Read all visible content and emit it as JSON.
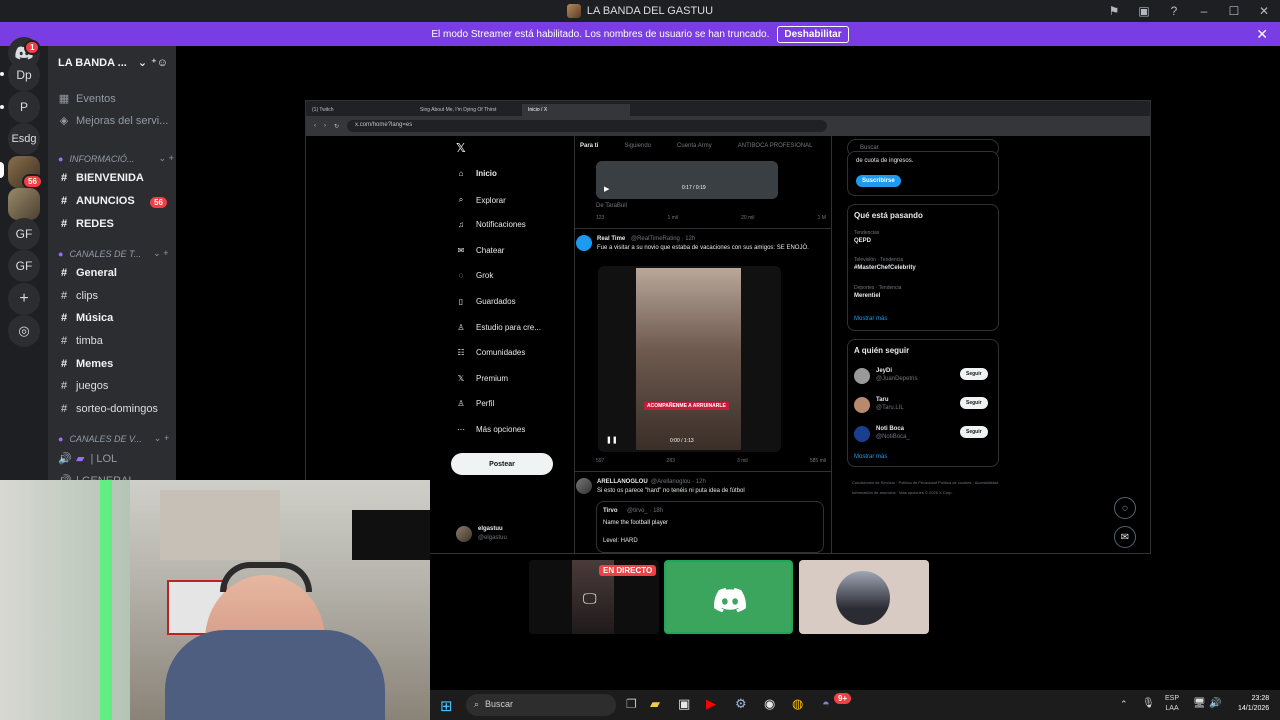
{
  "window": {
    "title": "LA BANDA DEL GASTUU"
  },
  "banner": {
    "text": "El modo Streamer está habilitado. Los nombres de usuario se han truncado.",
    "button": "Deshabilitar"
  },
  "rail": {
    "items": [
      "Dp",
      "P",
      "Esdg",
      "GF",
      "GF"
    ],
    "badges": {
      "home": "1",
      "server": "56"
    }
  },
  "sidebar": {
    "server_name": "LA BANDA ...",
    "top_items": [
      "Eventos",
      "Mejoras del servi..."
    ],
    "categories": [
      "INFORMACIÓ...",
      "CANALES DE T...",
      "CANALES DE V..."
    ],
    "info_channels": [
      "BIENVENIDA",
      "ANUNCIOS",
      "REDES"
    ],
    "anuncios_badge": "56",
    "text_channels": [
      "General",
      "clips",
      "Música",
      "timba",
      "Memes",
      "juegos",
      "sorteo-domingos"
    ],
    "voice_channels": [
      "| LOL",
      "| GENERAL"
    ]
  },
  "browser": {
    "tabs": [
      "(1) Twitch",
      "Sing About Me, I'm Dying Of Thirst",
      "Inicio / X"
    ],
    "url": "x.com/home?lang=es"
  },
  "x": {
    "nav": [
      "Inicio",
      "Explorar",
      "Notificaciones",
      "Chatear",
      "Grok",
      "Guardados",
      "Estudio para cre...",
      "Comunidades",
      "Premium",
      "Perfil",
      "Más opciones"
    ],
    "post_button": "Postear",
    "account": {
      "name": "elgastuu",
      "handle": "@elgastuu"
    },
    "feed_tabs": [
      "Para ti",
      "Siguiendo",
      "Cuenta Army",
      "ANTIBOCA PROFESIONAL"
    ],
    "post1": {
      "source": "De TaraBull",
      "counts": [
        "123",
        "1 mil",
        "20 mil",
        "1 M"
      ],
      "time": "0:17 / 0:19"
    },
    "post2": {
      "name": "Real Time",
      "handle": "@RealTimeRating · 12h",
      "text": "Fue a visitar a su novio que estaba de vacaciones con sus amigos: SE ENOJÓ.",
      "caption": "ACOMPAÑENME A ARRUINARLE",
      "time": "0:00 / 1:13",
      "counts": [
        "597",
        "283",
        "3 mil",
        "585 mil"
      ]
    },
    "post3": {
      "name": "ARELLANOGLOU",
      "handle": "@Arellanoglou · 12h",
      "text": "Si esto os parece \"hard\" no tenéis ni puta idea de fútbol",
      "quote_name": "Tirvo",
      "quote_handle": "@tirvo_ · 18h",
      "quote_text": "Name the football player",
      "quote_level": "Level: HARD"
    },
    "search_placeholder": "Buscar",
    "subscribe": {
      "text": "de cuota de ingresos.",
      "button": "Suscribirse"
    },
    "trends": {
      "title": "Qué está pasando",
      "items": [
        {
          "meta": "Tendencias",
          "name": "QEPD"
        },
        {
          "meta": "Televisión · Tendencia",
          "name": "#MasterChefCelebrity"
        },
        {
          "meta": "Deportes · Tendencia",
          "name": "Merentiel"
        }
      ],
      "more": "Mostrar más"
    },
    "follow": {
      "title": "A quién seguir",
      "items": [
        {
          "name": "JeyDi",
          "handle": "@JuanDepetris"
        },
        {
          "name": "Taru",
          "handle": "@Taru.LIL"
        },
        {
          "name": "Noti Boca",
          "handle": "@NotiBoca_"
        }
      ],
      "button": "Seguir",
      "more": "Mostrar más"
    },
    "footer": [
      "Condiciones de Servicio",
      "Política de Privacidad",
      "Política de cookies",
      "Accesibilidad",
      "Información de anuncios",
      "Más opciones",
      "© 2026 X Corp."
    ]
  },
  "stream": {
    "live_badge": "EN DIRECTO"
  },
  "taskbar": {
    "search": "Buscar",
    "lang": "ESP",
    "lang2": "LAA",
    "time": "23:28",
    "date": "14/1/2026",
    "discord_badge": "9+"
  }
}
